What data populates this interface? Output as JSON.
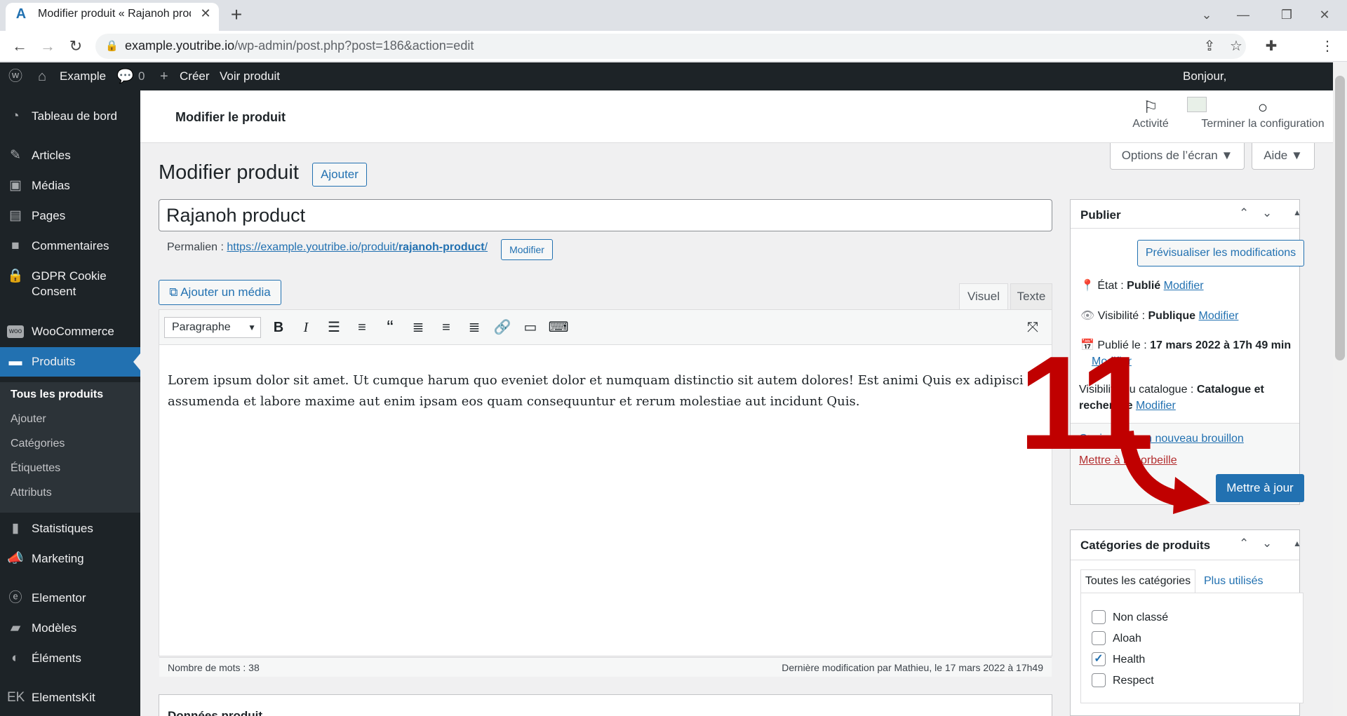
{
  "browser": {
    "tab_title": "Modifier produit « Rajanoh prod",
    "url_host": "example.youtribe.io",
    "url_path": "/wp-admin/post.php?post=186&action=edit"
  },
  "adminbar": {
    "site_name": "Example",
    "comments_count": "0",
    "new_label": "Créer",
    "view_label": "Voir produit",
    "greeting": "Bonjour,"
  },
  "sidebar": {
    "items": [
      {
        "label": "Tableau de bord",
        "icon": "dashboard-icon"
      },
      {
        "label": "Articles",
        "icon": "pin-icon"
      },
      {
        "label": "Médias",
        "icon": "media-icon"
      },
      {
        "label": "Pages",
        "icon": "pages-icon"
      },
      {
        "label": "Commentaires",
        "icon": "comments-icon"
      },
      {
        "label": "GDPR Cookie Consent",
        "icon": "lock-icon"
      },
      {
        "label": "WooCommerce",
        "icon": "woo-icon"
      },
      {
        "label": "Produits",
        "icon": "products-icon"
      },
      {
        "label": "Statistiques",
        "icon": "stats-icon"
      },
      {
        "label": "Marketing",
        "icon": "megaphone-icon"
      },
      {
        "label": "Elementor",
        "icon": "elementor-icon"
      },
      {
        "label": "Modèles",
        "icon": "folder-icon"
      },
      {
        "label": "Éléments",
        "icon": "elements-icon"
      },
      {
        "label": "ElementsKit",
        "icon": "elementskit-icon"
      }
    ],
    "submenu": [
      "Tous les produits",
      "Ajouter",
      "Catégories",
      "Étiquettes",
      "Attributs"
    ]
  },
  "header": {
    "title": "Modifier le produit",
    "activity_label": "Activité",
    "setup_label": "Terminer la configuration"
  },
  "screen_options": {
    "options_label": "Options de l’écran ▼",
    "help_label": "Aide ▼"
  },
  "main": {
    "heading": "Modifier produit",
    "add_new_label": "Ajouter",
    "title_value": "Rajanoh product",
    "permalink_label": "Permalien :",
    "permalink_url_start": "https://example.youtribe.io/produit/",
    "permalink_slug": "rajanoh-product",
    "permalink_url_end": "/",
    "permalink_edit": "Modifier",
    "add_media_label": "Ajouter un média",
    "tab_visual": "Visuel",
    "tab_text": "Texte",
    "format_select": "Paragraphe",
    "content": "Lorem ipsum dolor sit amet. Ut cumque harum quo eveniet dolor et numquam distinctio sit autem dolores! Est animi Quis ex adipisci assumenda et labore maxime aut enim ipsam eos quam consequuntur et rerum molestiae aut incidunt Quis.",
    "word_count": "Nombre de mots : 38",
    "last_modified": "Dernière modification par Mathieu, le 17 mars 2022 à 17h49",
    "product_data_label": "Données produit"
  },
  "publish": {
    "title": "Publier",
    "preview_label": "Prévisualiser les modifications",
    "status_label": "État : ",
    "status_value": "Publié",
    "visibility_label": "Visibilité : ",
    "visibility_value": "Publique",
    "published_label": "Publié le : ",
    "published_value": "17 mars 2022 à 17h 49 min",
    "catalog_label": "Visibilité du catalogue : ",
    "catalog_value_1": "Catalogue et",
    "catalog_value_2": "recherche",
    "edit_label": "Modifier",
    "copy_draft_label": "Copier vers un nouveau brouillon",
    "trash_label": "Mettre à la corbeille",
    "update_label": "Mettre à jour"
  },
  "categories": {
    "title": "Catégories de produits",
    "tab_all": "Toutes les catégories",
    "tab_popular": "Plus utilisés",
    "items": [
      {
        "label": "Non classé",
        "checked": false
      },
      {
        "label": "Aloah",
        "checked": false
      },
      {
        "label": "Health",
        "checked": true
      },
      {
        "label": "Respect",
        "checked": false
      }
    ]
  },
  "overlay": {
    "step_number": "11",
    "color": "#c00000"
  },
  "colors": {
    "accent": "#2271b1",
    "admin_bg": "#1d2327",
    "overlay": "#c00000"
  }
}
